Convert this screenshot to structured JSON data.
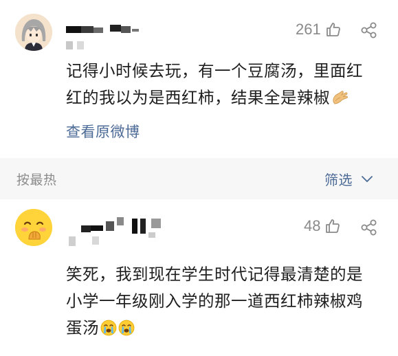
{
  "comment1": {
    "likes": "261",
    "text_line1": "记得小时候去玩，有一个豆腐汤，里面红",
    "text_line2": "红的我以为是西红柿，结果全是辣椒",
    "trailing_emoji": "hand-clap-emoji",
    "view_original": "查看原微博"
  },
  "sortbar": {
    "sort_label": "按最热",
    "filter_label": "筛选"
  },
  "comment2": {
    "likes": "48",
    "text_line1": "笑死，我到现在学生时代记得最清楚的是",
    "text_line2": "小学一年级刚入学的那一道西红柿辣椒鸡",
    "text_line3": "蛋汤",
    "trailing_emoji": "crying-emoji"
  },
  "colors": {
    "link": "#4b6a96",
    "muted": "#8a8a8a",
    "text": "#1f1f1f"
  }
}
